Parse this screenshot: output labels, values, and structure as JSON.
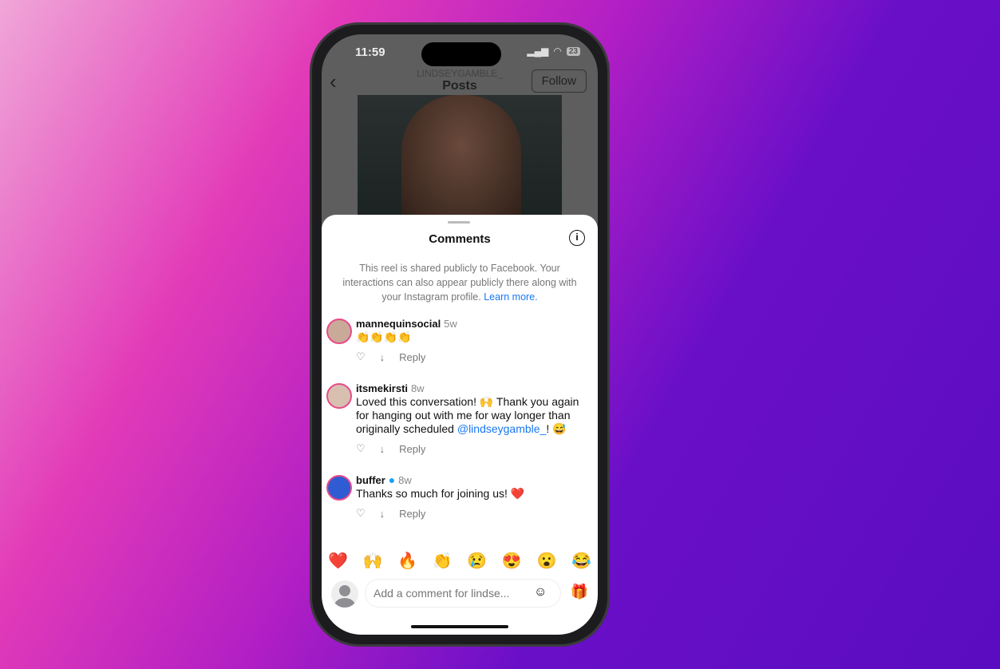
{
  "status": {
    "time": "11:59",
    "battery": "23"
  },
  "nav": {
    "username": "LINDSEYGAMBLE_",
    "title": "Posts",
    "follow": "Follow"
  },
  "sheet": {
    "title": "Comments",
    "notice": "This reel is shared publicly to Facebook. Your interactions can also appear publicly there along with your Instagram profile.",
    "learn_more": "Learn more."
  },
  "comments": [
    {
      "user": "mannequinsocial",
      "time": "5w",
      "text": "👏👏👏👏",
      "reply": "Reply"
    },
    {
      "user": "itsmekirsti",
      "time": "8w",
      "text": "Loved this conversation! 🙌 Thank you again for hanging out with me for way longer than originally scheduled ",
      "mention": "@lindseygamble_",
      "after": "! 😅",
      "reply": "Reply"
    },
    {
      "user": "buffer",
      "time": "8w",
      "verified": true,
      "text": "Thanks so much for joining us! ❤️",
      "reply": "Reply"
    }
  ],
  "emojis": [
    "❤️",
    "🙌",
    "🔥",
    "👏",
    "😢",
    "😍",
    "😮",
    "😂"
  ],
  "input": {
    "placeholder": "Add a comment for lindse..."
  }
}
